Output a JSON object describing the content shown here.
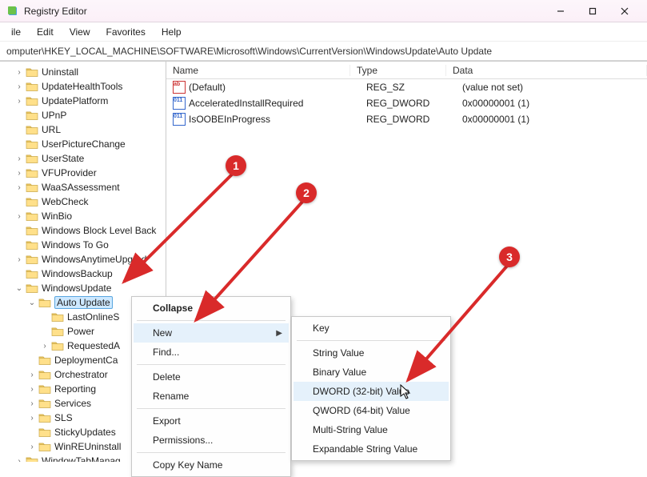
{
  "window": {
    "title": "Registry Editor"
  },
  "menu": {
    "file": "ile",
    "edit": "Edit",
    "view": "View",
    "favorites": "Favorites",
    "help": "Help"
  },
  "addressbar": {
    "path": "omputer\\HKEY_LOCAL_MACHINE\\SOFTWARE\\Microsoft\\Windows\\CurrentVersion\\WindowsUpdate\\Auto Update"
  },
  "tree": [
    {
      "d": 1,
      "exp": ">",
      "label": "Uninstall"
    },
    {
      "d": 1,
      "exp": ">",
      "label": "UpdateHealthTools"
    },
    {
      "d": 1,
      "exp": ">",
      "label": "UpdatePlatform"
    },
    {
      "d": 1,
      "exp": "",
      "label": "UPnP"
    },
    {
      "d": 1,
      "exp": "",
      "label": "URL"
    },
    {
      "d": 1,
      "exp": "",
      "label": "UserPictureChange"
    },
    {
      "d": 1,
      "exp": ">",
      "label": "UserState"
    },
    {
      "d": 1,
      "exp": ">",
      "label": "VFUProvider"
    },
    {
      "d": 1,
      "exp": ">",
      "label": "WaaSAssessment"
    },
    {
      "d": 1,
      "exp": "",
      "label": "WebCheck"
    },
    {
      "d": 1,
      "exp": ">",
      "label": "WinBio"
    },
    {
      "d": 1,
      "exp": "",
      "label": "Windows Block Level Back"
    },
    {
      "d": 1,
      "exp": "",
      "label": "Windows To Go"
    },
    {
      "d": 1,
      "exp": ">",
      "label": "WindowsAnytimeUpgrad"
    },
    {
      "d": 1,
      "exp": "",
      "label": "WindowsBackup"
    },
    {
      "d": 1,
      "exp": "v",
      "label": "WindowsUpdate"
    },
    {
      "d": 2,
      "exp": "v",
      "label": "Auto Update",
      "selected": true
    },
    {
      "d": 3,
      "exp": "",
      "label": "LastOnlineS"
    },
    {
      "d": 3,
      "exp": "",
      "label": "Power"
    },
    {
      "d": 3,
      "exp": ">",
      "label": "RequestedA"
    },
    {
      "d": 2,
      "exp": "",
      "label": "DeploymentCa"
    },
    {
      "d": 2,
      "exp": ">",
      "label": "Orchestrator"
    },
    {
      "d": 2,
      "exp": ">",
      "label": "Reporting"
    },
    {
      "d": 2,
      "exp": ">",
      "label": "Services"
    },
    {
      "d": 2,
      "exp": ">",
      "label": "SLS"
    },
    {
      "d": 2,
      "exp": "",
      "label": "StickyUpdates"
    },
    {
      "d": 2,
      "exp": ">",
      "label": "WinREUninstall"
    },
    {
      "d": 1,
      "exp": ">",
      "label": "WindowTabManag"
    }
  ],
  "list": {
    "headers": {
      "name": "Name",
      "type": "Type",
      "data": "Data"
    },
    "rows": [
      {
        "icon": "sz",
        "name": "(Default)",
        "type": "REG_SZ",
        "data": "(value not set)"
      },
      {
        "icon": "dw",
        "name": "AcceleratedInstallRequired",
        "type": "REG_DWORD",
        "data": "0x00000001 (1)"
      },
      {
        "icon": "dw",
        "name": "IsOOBEInProgress",
        "type": "REG_DWORD",
        "data": "0x00000001 (1)"
      }
    ]
  },
  "context_menu": {
    "collapse": "Collapse",
    "new": "New",
    "find": "Find...",
    "delete": "Delete",
    "rename": "Rename",
    "export": "Export",
    "permissions": "Permissions...",
    "copy_key_name": "Copy Key Name"
  },
  "submenu": {
    "key": "Key",
    "string": "String Value",
    "binary": "Binary Value",
    "dword": "DWORD (32-bit) Value",
    "qword": "QWORD (64-bit) Value",
    "multi": "Multi-String Value",
    "expand": "Expandable String Value"
  },
  "annotations": {
    "1": "1",
    "2": "2",
    "3": "3"
  }
}
